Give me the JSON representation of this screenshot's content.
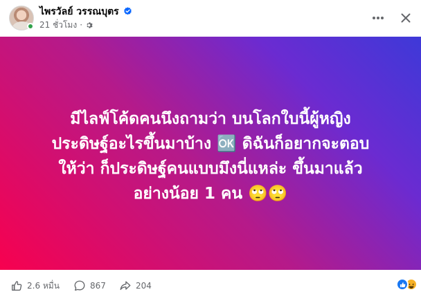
{
  "post": {
    "author": "ไพรวัลย์ วรรณบุตร",
    "time": "21 ชั่วโมง",
    "separator": "·",
    "verified": true,
    "card": {
      "lines": [
        "มีไลฟ์โค้ดคนนึงถามว่า บนโลกใบนี้ผู้หญิง",
        "ประดิษฐ์อะไรขึ้นมาบ้าง 🆗️ ดิฉันก็อยากจะตอบ",
        "ให้ว่า ก็ประดิษฐ์คนแบบมึงนี่แหล่ะ ขึ้นมาแล้ว",
        "อย่างน้อย 1 คน 🙄🙄"
      ],
      "gradient": [
        "#f7014f",
        "#b51a8a",
        "#6b2bd1",
        "#3e39d8"
      ]
    }
  },
  "actions": {
    "likes": "2.6 หมื่น",
    "comments": "867",
    "shares": "204"
  },
  "reactions": [
    "like-icon",
    "haha-icon"
  ],
  "colors": {
    "verified": "#0866ff",
    "meta": "#65676b",
    "online": "#31a24c"
  }
}
